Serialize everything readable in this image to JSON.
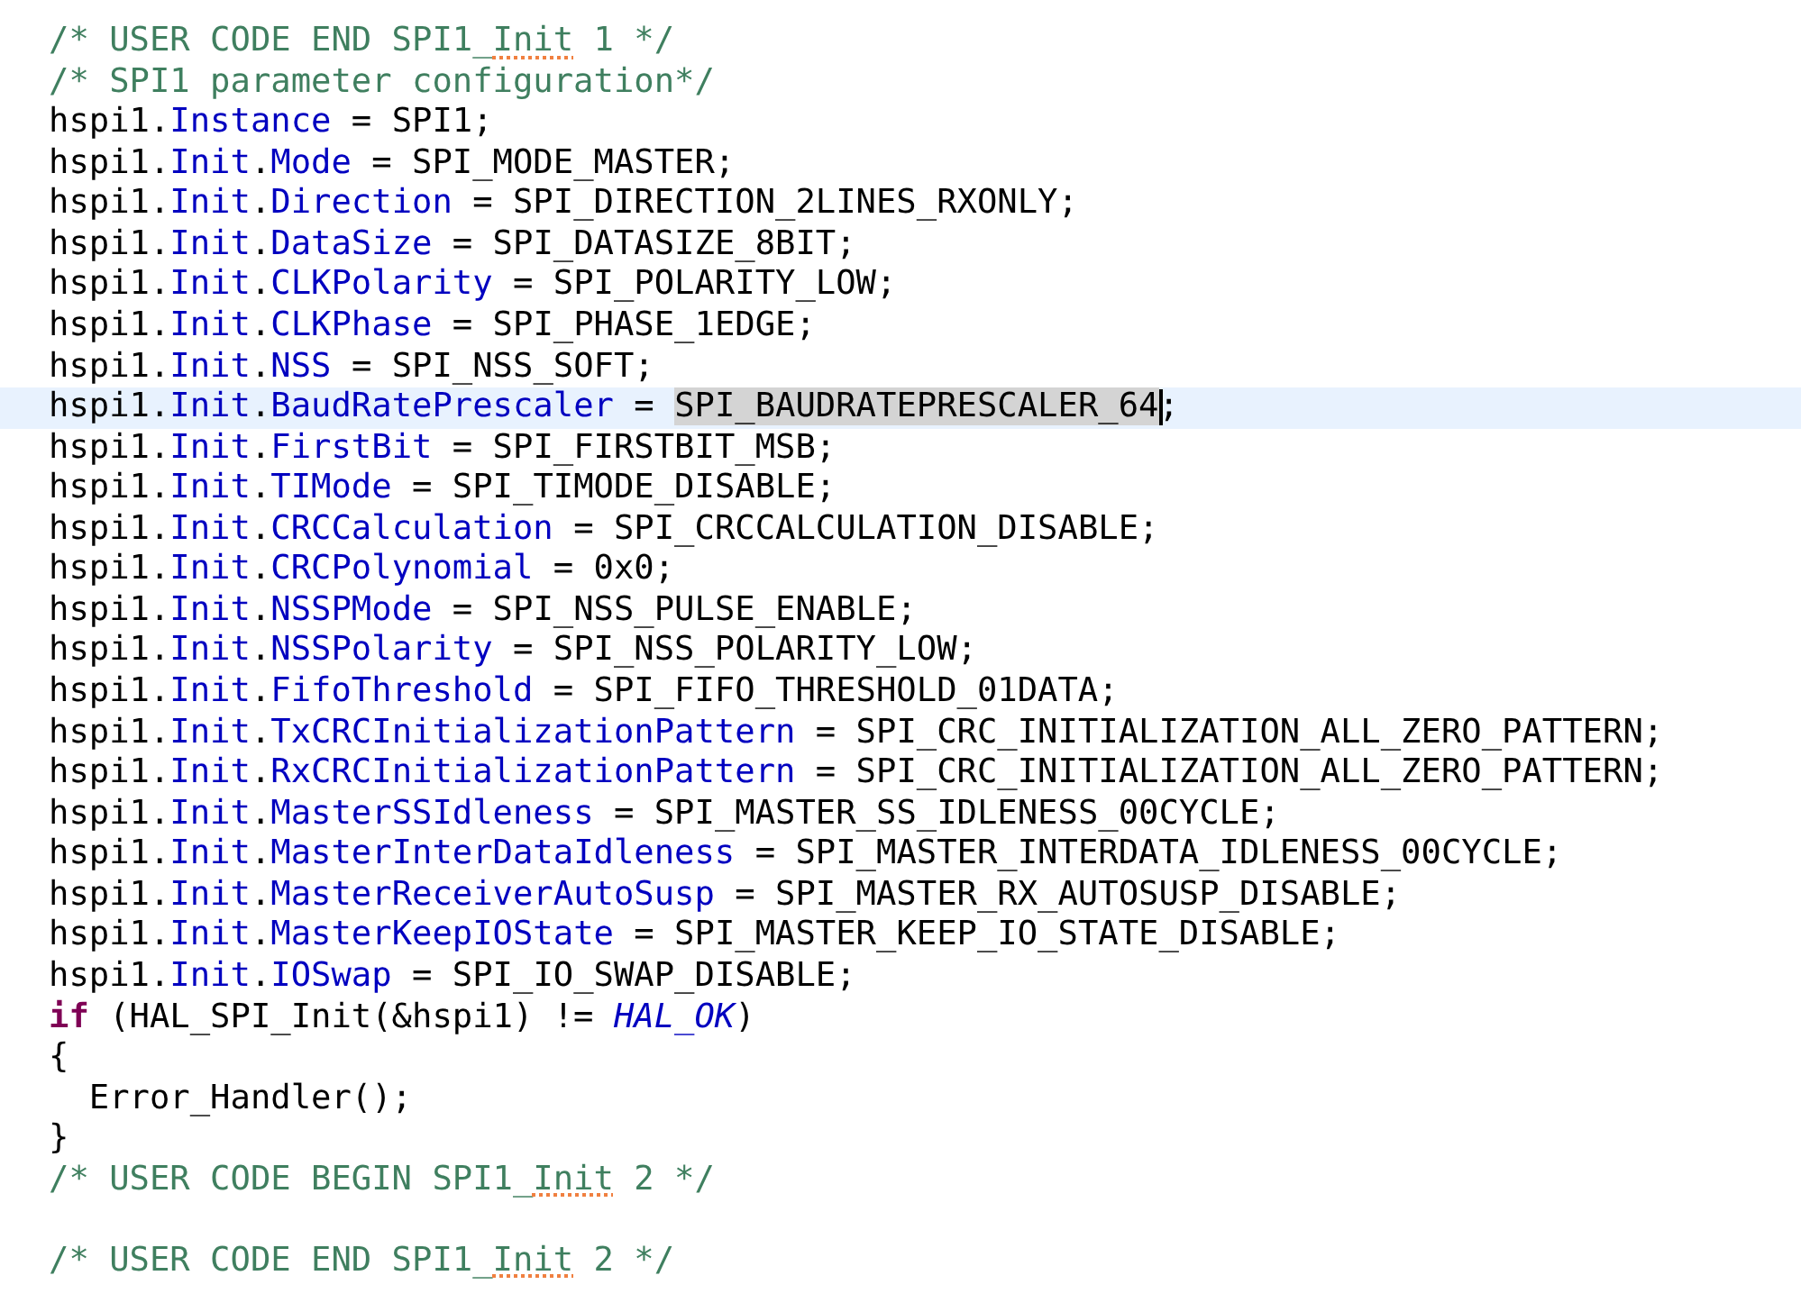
{
  "editor": {
    "lines": [
      {
        "current": false,
        "tokens": [
          {
            "kind": "comment",
            "text": "/* USER CODE END SPI1_"
          },
          {
            "kind": "spell",
            "text": "Init"
          },
          {
            "kind": "comment",
            "text": " 1 */"
          }
        ]
      },
      {
        "current": false,
        "tokens": [
          {
            "kind": "comment",
            "text": "/* SPI1 parameter configuration*/"
          }
        ]
      },
      {
        "current": false,
        "tokens": [
          {
            "kind": "plain",
            "text": "hspi1."
          },
          {
            "kind": "field",
            "text": "Instance"
          },
          {
            "kind": "plain",
            "text": " = SPI1;"
          }
        ]
      },
      {
        "current": false,
        "tokens": [
          {
            "kind": "plain",
            "text": "hspi1."
          },
          {
            "kind": "field",
            "text": "Init"
          },
          {
            "kind": "plain",
            "text": "."
          },
          {
            "kind": "field",
            "text": "Mode"
          },
          {
            "kind": "plain",
            "text": " = SPI_MODE_MASTER;"
          }
        ]
      },
      {
        "current": false,
        "tokens": [
          {
            "kind": "plain",
            "text": "hspi1."
          },
          {
            "kind": "field",
            "text": "Init"
          },
          {
            "kind": "plain",
            "text": "."
          },
          {
            "kind": "field",
            "text": "Direction"
          },
          {
            "kind": "plain",
            "text": " = SPI_DIRECTION_2LINES_RXONLY;"
          }
        ]
      },
      {
        "current": false,
        "tokens": [
          {
            "kind": "plain",
            "text": "hspi1."
          },
          {
            "kind": "field",
            "text": "Init"
          },
          {
            "kind": "plain",
            "text": "."
          },
          {
            "kind": "field",
            "text": "DataSize"
          },
          {
            "kind": "plain",
            "text": " = SPI_DATASIZE_8BIT;"
          }
        ]
      },
      {
        "current": false,
        "tokens": [
          {
            "kind": "plain",
            "text": "hspi1."
          },
          {
            "kind": "field",
            "text": "Init"
          },
          {
            "kind": "plain",
            "text": "."
          },
          {
            "kind": "field",
            "text": "CLKPolarity"
          },
          {
            "kind": "plain",
            "text": " = SPI_POLARITY_LOW;"
          }
        ]
      },
      {
        "current": false,
        "tokens": [
          {
            "kind": "plain",
            "text": "hspi1."
          },
          {
            "kind": "field",
            "text": "Init"
          },
          {
            "kind": "plain",
            "text": "."
          },
          {
            "kind": "field",
            "text": "CLKPhase"
          },
          {
            "kind": "plain",
            "text": " = SPI_PHASE_1EDGE;"
          }
        ]
      },
      {
        "current": false,
        "tokens": [
          {
            "kind": "plain",
            "text": "hspi1."
          },
          {
            "kind": "field",
            "text": "Init"
          },
          {
            "kind": "plain",
            "text": "."
          },
          {
            "kind": "field",
            "text": "NSS"
          },
          {
            "kind": "plain",
            "text": " = SPI_NSS_SOFT;"
          }
        ]
      },
      {
        "current": true,
        "tokens": [
          {
            "kind": "plain",
            "text": "hspi1."
          },
          {
            "kind": "field",
            "text": "Init"
          },
          {
            "kind": "plain",
            "text": "."
          },
          {
            "kind": "field",
            "text": "BaudRatePrescaler"
          },
          {
            "kind": "plain",
            "text": " = "
          },
          {
            "kind": "selection",
            "text": "SPI_BAUDRATEPRESCALER_64"
          },
          {
            "kind": "plain",
            "text": ";"
          }
        ]
      },
      {
        "current": false,
        "tokens": [
          {
            "kind": "plain",
            "text": "hspi1."
          },
          {
            "kind": "field",
            "text": "Init"
          },
          {
            "kind": "plain",
            "text": "."
          },
          {
            "kind": "field",
            "text": "FirstBit"
          },
          {
            "kind": "plain",
            "text": " = SPI_FIRSTBIT_MSB;"
          }
        ]
      },
      {
        "current": false,
        "tokens": [
          {
            "kind": "plain",
            "text": "hspi1."
          },
          {
            "kind": "field",
            "text": "Init"
          },
          {
            "kind": "plain",
            "text": "."
          },
          {
            "kind": "field",
            "text": "TIMode"
          },
          {
            "kind": "plain",
            "text": " = SPI_TIMODE_DISABLE;"
          }
        ]
      },
      {
        "current": false,
        "tokens": [
          {
            "kind": "plain",
            "text": "hspi1."
          },
          {
            "kind": "field",
            "text": "Init"
          },
          {
            "kind": "plain",
            "text": "."
          },
          {
            "kind": "field",
            "text": "CRCCalculation"
          },
          {
            "kind": "plain",
            "text": " = SPI_CRCCALCULATION_DISABLE;"
          }
        ]
      },
      {
        "current": false,
        "tokens": [
          {
            "kind": "plain",
            "text": "hspi1."
          },
          {
            "kind": "field",
            "text": "Init"
          },
          {
            "kind": "plain",
            "text": "."
          },
          {
            "kind": "field",
            "text": "CRCPolynomial"
          },
          {
            "kind": "plain",
            "text": " = 0x0;"
          }
        ]
      },
      {
        "current": false,
        "tokens": [
          {
            "kind": "plain",
            "text": "hspi1."
          },
          {
            "kind": "field",
            "text": "Init"
          },
          {
            "kind": "plain",
            "text": "."
          },
          {
            "kind": "field",
            "text": "NSSPMode"
          },
          {
            "kind": "plain",
            "text": " = SPI_NSS_PULSE_ENABLE;"
          }
        ]
      },
      {
        "current": false,
        "tokens": [
          {
            "kind": "plain",
            "text": "hspi1."
          },
          {
            "kind": "field",
            "text": "Init"
          },
          {
            "kind": "plain",
            "text": "."
          },
          {
            "kind": "field",
            "text": "NSSPolarity"
          },
          {
            "kind": "plain",
            "text": " = SPI_NSS_POLARITY_LOW;"
          }
        ]
      },
      {
        "current": false,
        "tokens": [
          {
            "kind": "plain",
            "text": "hspi1."
          },
          {
            "kind": "field",
            "text": "Init"
          },
          {
            "kind": "plain",
            "text": "."
          },
          {
            "kind": "field",
            "text": "FifoThreshold"
          },
          {
            "kind": "plain",
            "text": " = SPI_FIFO_THRESHOLD_01DATA;"
          }
        ]
      },
      {
        "current": false,
        "tokens": [
          {
            "kind": "plain",
            "text": "hspi1."
          },
          {
            "kind": "field",
            "text": "Init"
          },
          {
            "kind": "plain",
            "text": "."
          },
          {
            "kind": "field",
            "text": "TxCRCInitializationPattern"
          },
          {
            "kind": "plain",
            "text": " = SPI_CRC_INITIALIZATION_ALL_ZERO_PATTERN;"
          }
        ]
      },
      {
        "current": false,
        "tokens": [
          {
            "kind": "plain",
            "text": "hspi1."
          },
          {
            "kind": "field",
            "text": "Init"
          },
          {
            "kind": "plain",
            "text": "."
          },
          {
            "kind": "field",
            "text": "RxCRCInitializationPattern"
          },
          {
            "kind": "plain",
            "text": " = SPI_CRC_INITIALIZATION_ALL_ZERO_PATTERN;"
          }
        ]
      },
      {
        "current": false,
        "tokens": [
          {
            "kind": "plain",
            "text": "hspi1."
          },
          {
            "kind": "field",
            "text": "Init"
          },
          {
            "kind": "plain",
            "text": "."
          },
          {
            "kind": "field",
            "text": "MasterSSIdleness"
          },
          {
            "kind": "plain",
            "text": " = SPI_MASTER_SS_IDLENESS_00CYCLE;"
          }
        ]
      },
      {
        "current": false,
        "tokens": [
          {
            "kind": "plain",
            "text": "hspi1."
          },
          {
            "kind": "field",
            "text": "Init"
          },
          {
            "kind": "plain",
            "text": "."
          },
          {
            "kind": "field",
            "text": "MasterInterDataIdleness"
          },
          {
            "kind": "plain",
            "text": " = SPI_MASTER_INTERDATA_IDLENESS_00CYCLE;"
          }
        ]
      },
      {
        "current": false,
        "tokens": [
          {
            "kind": "plain",
            "text": "hspi1."
          },
          {
            "kind": "field",
            "text": "Init"
          },
          {
            "kind": "plain",
            "text": "."
          },
          {
            "kind": "field",
            "text": "MasterReceiverAutoSusp"
          },
          {
            "kind": "plain",
            "text": " = SPI_MASTER_RX_AUTOSUSP_DISABLE;"
          }
        ]
      },
      {
        "current": false,
        "tokens": [
          {
            "kind": "plain",
            "text": "hspi1."
          },
          {
            "kind": "field",
            "text": "Init"
          },
          {
            "kind": "plain",
            "text": "."
          },
          {
            "kind": "field",
            "text": "MasterKeepIOState"
          },
          {
            "kind": "plain",
            "text": " = SPI_MASTER_KEEP_IO_STATE_DISABLE;"
          }
        ]
      },
      {
        "current": false,
        "tokens": [
          {
            "kind": "plain",
            "text": "hspi1."
          },
          {
            "kind": "field",
            "text": "Init"
          },
          {
            "kind": "plain",
            "text": "."
          },
          {
            "kind": "field",
            "text": "IOSwap"
          },
          {
            "kind": "plain",
            "text": " = SPI_IO_SWAP_DISABLE;"
          }
        ]
      },
      {
        "current": false,
        "tokens": [
          {
            "kind": "keyword",
            "text": "if"
          },
          {
            "kind": "plain",
            "text": " (HAL_SPI_Init(&hspi1) != "
          },
          {
            "kind": "constant",
            "text": "HAL_OK"
          },
          {
            "kind": "plain",
            "text": ")"
          }
        ]
      },
      {
        "current": false,
        "tokens": [
          {
            "kind": "plain",
            "text": "{"
          }
        ]
      },
      {
        "current": false,
        "tokens": [
          {
            "kind": "plain",
            "text": "  Error_Handler();"
          }
        ]
      },
      {
        "current": false,
        "tokens": [
          {
            "kind": "plain",
            "text": "}"
          }
        ]
      },
      {
        "current": false,
        "tokens": [
          {
            "kind": "comment",
            "text": "/* USER CODE BEGIN SPI1_"
          },
          {
            "kind": "spell",
            "text": "Init"
          },
          {
            "kind": "comment",
            "text": " 2 */"
          }
        ]
      },
      {
        "current": false
      },
      {
        "current": false,
        "tokens": [
          {
            "kind": "comment",
            "text": "/* USER CODE END SPI1_"
          },
          {
            "kind": "spell",
            "text": "Init"
          },
          {
            "kind": "comment",
            "text": " 2 */"
          }
        ]
      }
    ]
  }
}
